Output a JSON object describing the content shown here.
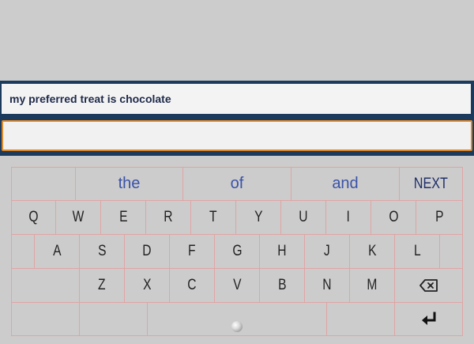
{
  "prompt": {
    "text": "my preferred treat is chocolate"
  },
  "input": {
    "value": ""
  },
  "keyboard": {
    "suggestions": [
      "the",
      "of",
      "and"
    ],
    "next_label": "NEXT",
    "row1": [
      "Q",
      "W",
      "E",
      "R",
      "T",
      "Y",
      "U",
      "I",
      "O",
      "P"
    ],
    "row2": [
      "A",
      "S",
      "D",
      "F",
      "G",
      "H",
      "J",
      "K",
      "L"
    ],
    "row3": [
      "Z",
      "X",
      "C",
      "V",
      "B",
      "N",
      "M"
    ],
    "backspace_icon": "backspace-icon",
    "enter_icon": "enter-icon",
    "colors": {
      "background": "#cccccc",
      "panel": "#1b3a5c",
      "input_border": "#e08a2a",
      "key_border": "#e0a4a4",
      "suggestion_text": "#3a52a8"
    }
  }
}
